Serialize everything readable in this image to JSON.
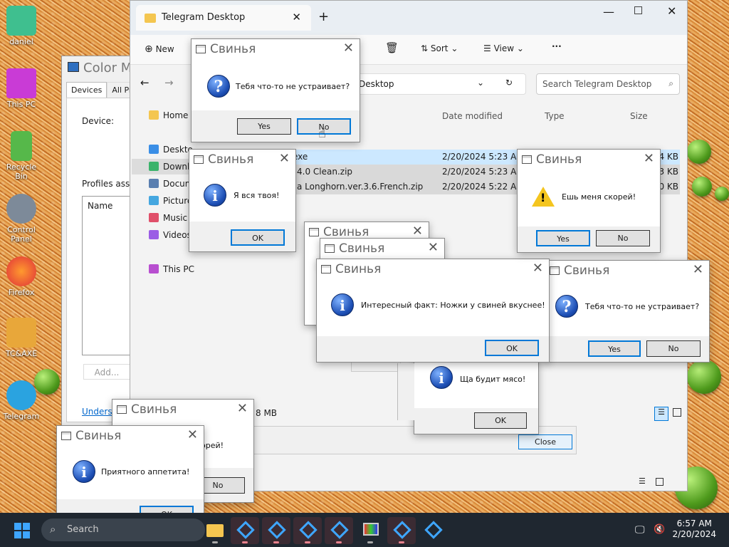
{
  "desktop_icons": [
    {
      "label": "daniel",
      "icon": "user-folder-icon"
    },
    {
      "label": "This PC",
      "icon": "monitor-icon"
    },
    {
      "label": "Recycle Bin",
      "icon": "recycle-bin-icon"
    },
    {
      "label": "Control Panel",
      "icon": "control-panel-icon"
    },
    {
      "label": "Firefox",
      "icon": "firefox-icon"
    },
    {
      "label": "TC&AXE",
      "icon": "star-icon"
    },
    {
      "label": "Telegram",
      "icon": "telegram-icon"
    }
  ],
  "color_mgmt": {
    "title": "Color M",
    "tab_devices": "Devices",
    "tab_profiles": "All Prof",
    "device_label": "Device:",
    "profiles_label": "Profiles asso",
    "name_header": "Name",
    "add_label": "Add...",
    "understand_link": "Underst"
  },
  "explorer": {
    "tab_title": "Telegram Desktop",
    "new_label": "New",
    "sort_label": "Sort",
    "view_label": "View",
    "more_label": "···",
    "address": "Desktop",
    "search_placeholder": "Search Telegram Desktop",
    "sidebar": [
      "Home",
      "Deskto",
      "Downlo",
      "Docum",
      "Picture",
      "Music",
      "Videos",
      "This PC"
    ],
    "columns": {
      "date": "Date modified",
      "type": "Type",
      "size": "Size"
    },
    "files": [
      {
        "name": "exe",
        "date": "2/20/2024 5:23 AM",
        "size": "4 KB"
      },
      {
        "name": "4.0 Clean.zip",
        "date": "2/20/2024 5:23 AM",
        "size": "3 KB"
      },
      {
        "name": "a Longhorn.ver.3.6.French.zip",
        "date": "2/20/2024 5:22 AM",
        "size": "0 KB"
      }
    ],
    "status_size": "8 MB"
  },
  "close_label": "Close",
  "dialogs": {
    "title": "Свинья",
    "d1_msg": "Тебя что-то не устраивает?",
    "d1_yes": "Yes",
    "d1_no": "No",
    "d2_msg": "Я вся твоя!",
    "d2_ok": "OK",
    "d3_msg": "Ешь меня скорей!",
    "d3_yes": "Yes",
    "d3_no": "No",
    "d4_msg": "Интересный факт: Ножки у свиней вкуснее!",
    "d4_ok": "OK",
    "d5_msg": "Тебя что-то не устраивает?",
    "d5_yes": "Yes",
    "d5_no": "No",
    "d6_msg": "Ща будит мясо!",
    "d6_ok": "OK",
    "d7_msg": "орей!",
    "d7_no": "No",
    "d8_msg": "Приятного аппетита!",
    "d8_ok": "OK"
  },
  "taskbar": {
    "search_placeholder": "Search",
    "time": "6:57 AM",
    "date": "2/20/2024"
  },
  "colors": {
    "accent": "#0078d7",
    "selection": "#cce8ff",
    "taskbar": "#1f2730"
  }
}
